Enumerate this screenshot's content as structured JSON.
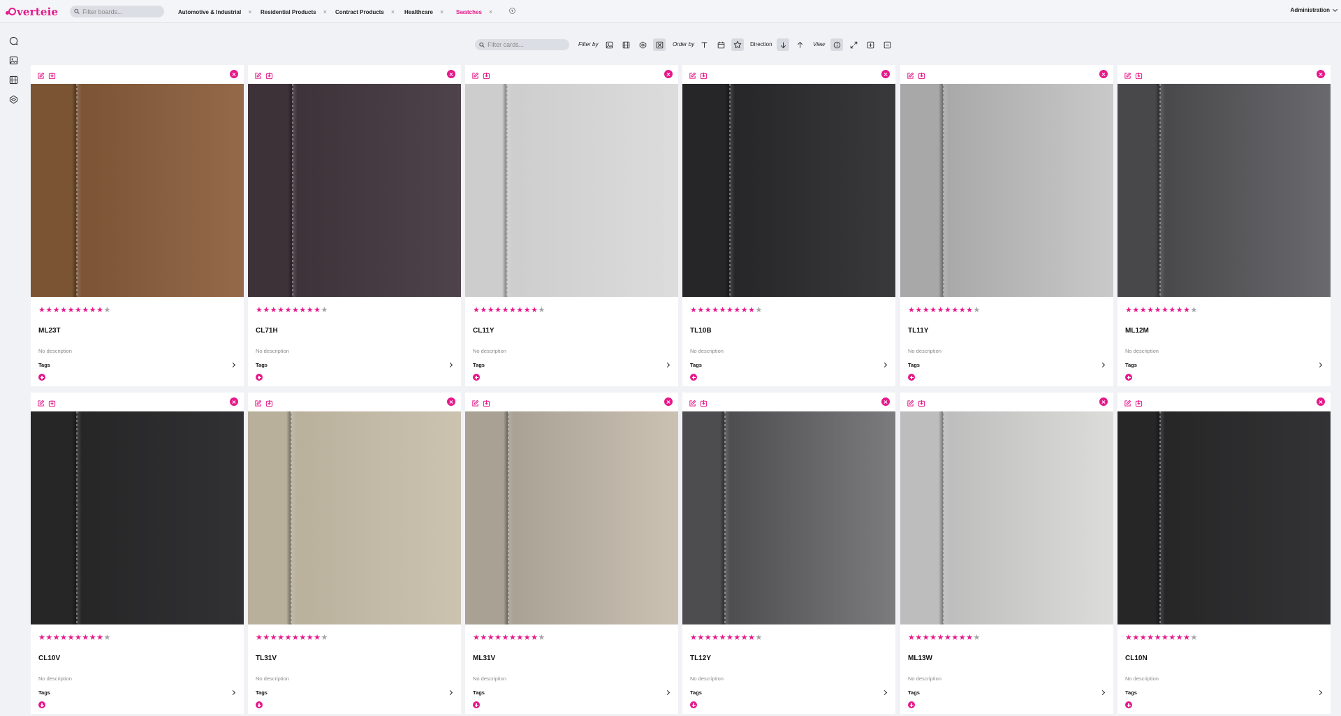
{
  "app": {
    "logo_text": "verteie",
    "colors": {
      "accent": "#e6198a"
    }
  },
  "board_search": {
    "placeholder": "Filter boards..."
  },
  "tabs": [
    {
      "label": "Automotive & Industrial",
      "active": false
    },
    {
      "label": "Residential Products",
      "active": false
    },
    {
      "label": "Contract Products",
      "active": false
    },
    {
      "label": "Healthcare",
      "active": false
    },
    {
      "label": "Swatches",
      "active": true
    }
  ],
  "tab_close_glyph": "×",
  "user_menu": {
    "label": "Administration"
  },
  "left_rail": [
    "chat-icon",
    "image-icon",
    "film-icon",
    "codepen-icon"
  ],
  "toolbar": {
    "search_placeholder": "Filter cards...",
    "filter_label": "Filter by",
    "filter_buttons": [
      "image-filter-icon",
      "video-filter-icon",
      "model-filter-icon",
      "other-filter-icon"
    ],
    "active_filter": "other-filter-icon",
    "order_label": "Order by",
    "order_buttons": [
      "order-title-icon",
      "order-date-icon",
      "order-rating-icon"
    ],
    "active_order": "order-rating-icon",
    "direction_label": "Direction",
    "direction": "descending",
    "view_label": "View",
    "active_view": "info-view-icon"
  },
  "cards": [
    {
      "title": "ML23T",
      "description": "No description",
      "tags_label": "Tags",
      "rating": 9,
      "max_rating": 10,
      "colors": [
        "#7b5434",
        "#94694a"
      ]
    },
    {
      "title": "CL71H",
      "description": "No description",
      "tags_label": "Tags",
      "rating": 9,
      "max_rating": 10,
      "colors": [
        "#3e3239",
        "#4f434b"
      ]
    },
    {
      "title": "CL11Y",
      "description": "No description",
      "tags_label": "Tags",
      "rating": 9,
      "max_rating": 10,
      "colors": [
        "#cdcdcd",
        "#dcdcdc"
      ]
    },
    {
      "title": "TL10B",
      "description": "No description",
      "tags_label": "Tags",
      "rating": 9,
      "max_rating": 10,
      "colors": [
        "#262628",
        "#39393b"
      ]
    },
    {
      "title": "TL11Y",
      "description": "No description",
      "tags_label": "Tags",
      "rating": 9,
      "max_rating": 10,
      "colors": [
        "#a8a8a8",
        "#c9c9c9"
      ]
    },
    {
      "title": "ML12M",
      "description": "No description",
      "tags_label": "Tags",
      "rating": 9,
      "max_rating": 10,
      "colors": [
        "#48484a",
        "#6a6a6e"
      ]
    },
    {
      "title": "CL10V",
      "description": "No description",
      "tags_label": "Tags",
      "rating": 9,
      "max_rating": 10,
      "colors": [
        "#262627",
        "#313133"
      ]
    },
    {
      "title": "TL31V",
      "description": "No description",
      "tags_label": "Tags",
      "rating": 9,
      "max_rating": 10,
      "colors": [
        "#b9b09c",
        "#cbc3b0"
      ]
    },
    {
      "title": "ML31V",
      "description": "No description",
      "tags_label": "Tags",
      "rating": 9,
      "max_rating": 10,
      "colors": [
        "#a8a194",
        "#cbc1b3"
      ]
    },
    {
      "title": "TL12Y",
      "description": "No description",
      "tags_label": "Tags",
      "rating": 9,
      "max_rating": 10,
      "colors": [
        "#4d4d4f",
        "#7c7c7e"
      ]
    },
    {
      "title": "ML13W",
      "description": "No description",
      "tags_label": "Tags",
      "rating": 9,
      "max_rating": 10,
      "colors": [
        "#bdbdbd",
        "#dcdcda"
      ]
    },
    {
      "title": "CL10N",
      "description": "No description",
      "tags_label": "Tags",
      "rating": 9,
      "max_rating": 10,
      "colors": [
        "#262627",
        "#333335"
      ]
    }
  ]
}
